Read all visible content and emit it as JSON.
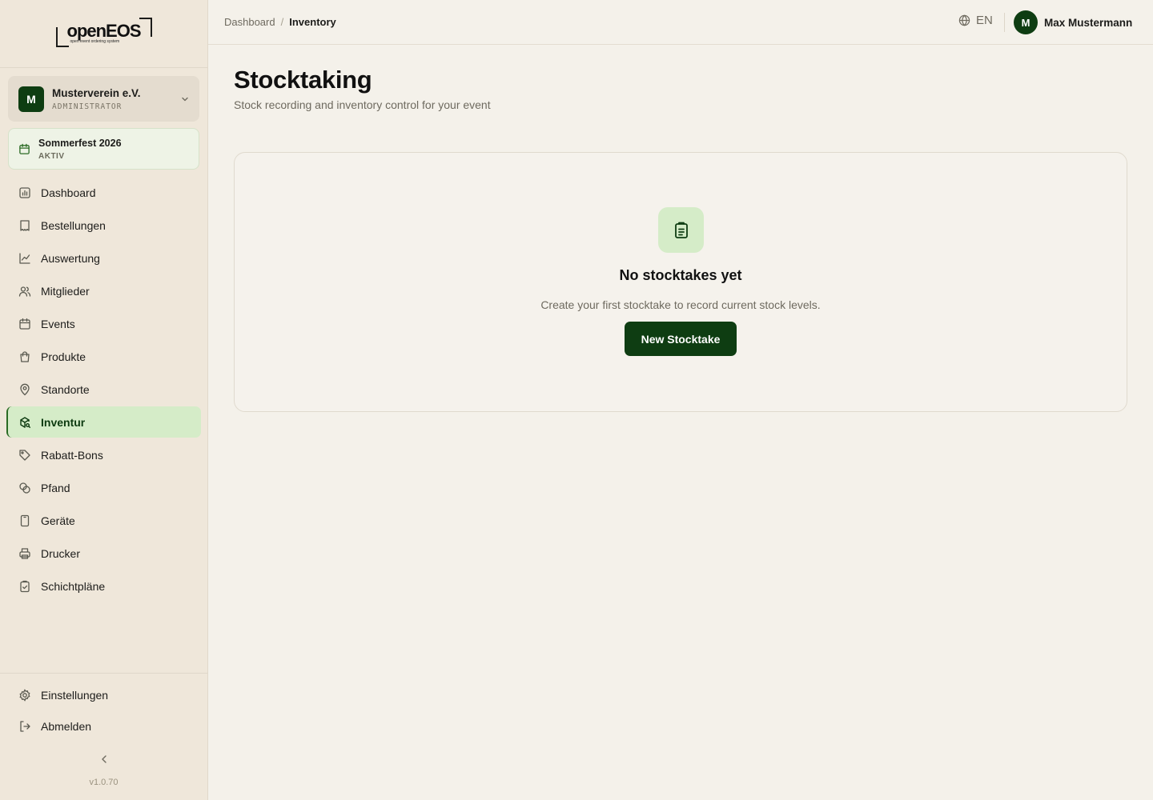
{
  "brand": {
    "name": "openEOS",
    "tagline": "open event ordering system"
  },
  "org": {
    "initial": "M",
    "name": "Musterverein e.V.",
    "role": "ADMINISTRATOR"
  },
  "event": {
    "name": "Sommerfest 2026",
    "status": "AKTIV"
  },
  "nav": {
    "items": [
      {
        "label": "Dashboard",
        "icon": "dashboard-icon"
      },
      {
        "label": "Bestellungen",
        "icon": "receipt-icon"
      },
      {
        "label": "Auswertung",
        "icon": "chart-line-icon"
      },
      {
        "label": "Mitglieder",
        "icon": "users-icon"
      },
      {
        "label": "Events",
        "icon": "calendar-icon"
      },
      {
        "label": "Produkte",
        "icon": "shopping-bag-icon"
      },
      {
        "label": "Standorte",
        "icon": "map-pin-icon"
      },
      {
        "label": "Inventur",
        "icon": "package-search-icon",
        "active": true
      },
      {
        "label": "Rabatt-Bons",
        "icon": "tag-icon"
      },
      {
        "label": "Pfand",
        "icon": "coins-icon"
      },
      {
        "label": "Geräte",
        "icon": "tablet-icon"
      },
      {
        "label": "Drucker",
        "icon": "printer-icon"
      },
      {
        "label": "Schichtpläne",
        "icon": "clipboard-check-icon"
      }
    ]
  },
  "footer": {
    "settings_label": "Einstellungen",
    "logout_label": "Abmelden",
    "version": "v1.0.70"
  },
  "header": {
    "breadcrumb_root": "Dashboard",
    "breadcrumb_sep": "/",
    "breadcrumb_current": "Inventory",
    "language": "EN",
    "user_initial": "M",
    "user_name": "Max Mustermann"
  },
  "page": {
    "title": "Stocktaking",
    "subtitle": "Stock recording and inventory control for your event"
  },
  "empty_state": {
    "title": "No stocktakes yet",
    "description": "Create your first stocktake to record current stock levels.",
    "button_label": "New Stocktake"
  },
  "colors": {
    "accent": "#0e3d12",
    "active_bg": "#d5ecc8",
    "sidebar_bg": "#efe7da",
    "page_bg": "#f4f1ea"
  }
}
